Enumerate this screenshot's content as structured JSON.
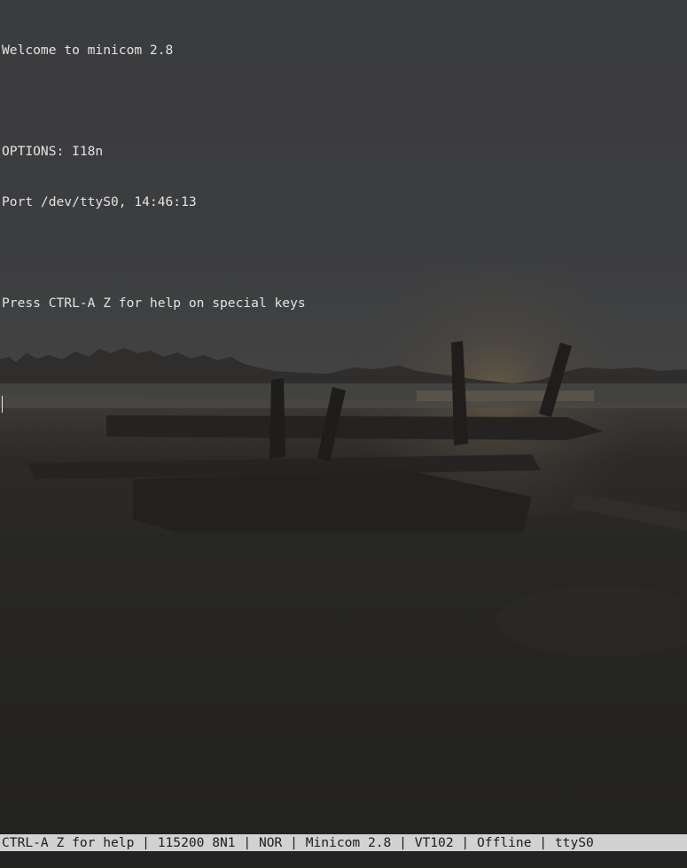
{
  "screen": {
    "lines": [
      "Welcome to minicom 2.8",
      "",
      "OPTIONS: I18n",
      "Port /dev/ttyS0, 14:46:13",
      "",
      "Press CTRL-A Z for help on special keys",
      ""
    ]
  },
  "status_bar": {
    "help": "CTRL-A Z for help",
    "settings": "115200 8N1",
    "mode": "NOR",
    "program": "Minicom 2.8",
    "terminal_type": "VT102",
    "connection": "Offline",
    "device": "ttyS0",
    "separator": " | "
  },
  "colors": {
    "status_bar_background": "#d2d2d2",
    "status_bar_text": "#1c1c1c",
    "terminal_text": "#e3e3e3"
  }
}
